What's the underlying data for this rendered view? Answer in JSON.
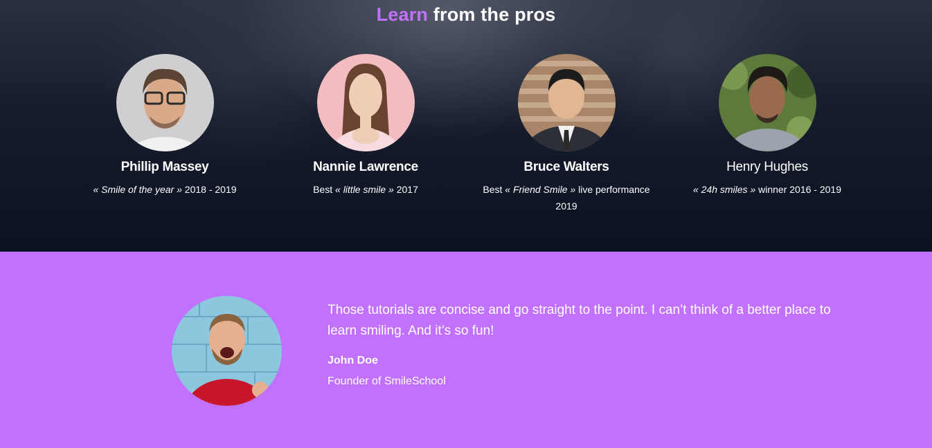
{
  "section_pros": {
    "title_accent": "Learn",
    "title_rest": " from the pros",
    "pros": [
      {
        "name": "Phillip Massey",
        "prefix": "",
        "award": "« Smile of the year »",
        "suffix": " 2018 - 2019"
      },
      {
        "name": "Nannie Lawrence",
        "prefix": "Best ",
        "award": "« little smile »",
        "suffix": " 2017"
      },
      {
        "name": "Bruce Walters",
        "prefix": "Best ",
        "award": "« Friend Smile »",
        "suffix": " live performance 2019"
      },
      {
        "name": "Henry Hughes",
        "prefix": "",
        "award": "« 24h smiles »",
        "suffix": " winner 2016 - 2019"
      }
    ]
  },
  "section_quote": {
    "text": "Those tutorials are concise and go straight to the point. I can’t think of a better place to learn smiling. And it’s so fun!",
    "author": "John Doe",
    "role": "Founder of SmileSchool"
  },
  "colors": {
    "accent": "#c271ff",
    "dark_bg": "#0a1222",
    "text": "#ffffff"
  }
}
